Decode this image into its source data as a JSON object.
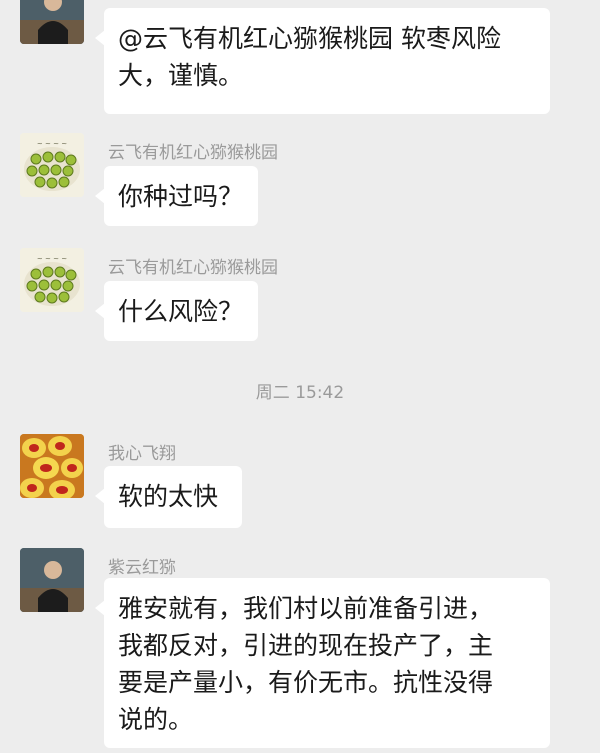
{
  "messages": [
    {
      "sender": "",
      "avatar": "person-avatar",
      "lines": [
        "@云飞有机红心猕猴桃园  软枣风险",
        "大，谨慎。"
      ]
    },
    {
      "sender": "云飞有机红心猕猴桃园",
      "avatar": "kiwi-plate-avatar",
      "lines": [
        "你种过吗？"
      ]
    },
    {
      "sender": "云飞有机红心猕猴桃园",
      "avatar": "kiwi-plate-avatar",
      "lines": [
        "什么风险？"
      ]
    },
    {
      "timestamp": "周二 15:42"
    },
    {
      "sender": "我心飞翔",
      "avatar": "red-kiwi-avatar",
      "lines": [
        "软的太快"
      ]
    },
    {
      "sender": "紫云红猕",
      "avatar": "person-avatar",
      "lines": [
        "雅安就有，我们村以前准备引进，",
        "我都反对，引进的现在投产了，主",
        "要是产量小，有价无市。抗性没得",
        "说的。"
      ]
    }
  ]
}
